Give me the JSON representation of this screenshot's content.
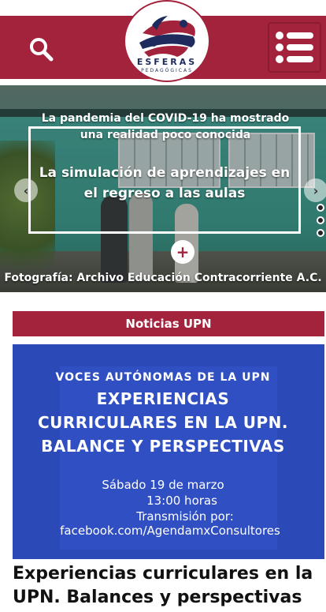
{
  "header": {
    "logo_text": "ESFERAS",
    "logo_subtext": "PEDAGÓGICAS",
    "colors": {
      "brand": "#a3233d",
      "logo_navy": "#1e2b5c"
    }
  },
  "slider": {
    "kicker": "La pandemia del COVID-19 ha mostrado una realidad poco conocida",
    "title": "La simulación de aprendizajes en el regreso a las aulas",
    "caption": "Fotografía: Archivo Educación Contracorriente A.C.",
    "plus_label": "+",
    "prev_icon": "‹",
    "next_icon": "›"
  },
  "section": {
    "title": "Noticias UPN"
  },
  "card": {
    "kicker": "VOCES AUTÓNOMAS DE LA UPN",
    "headline": "EXPERIENCIAS CURRICULARES EN LA UPN. BALANCE Y PERSPECTIVAS",
    "date": "Sábado 19 de marzo",
    "time": "13:00 horas",
    "transmission": "Transmisión por:",
    "link": "facebook.com/AgendamxConsultores",
    "colors": {
      "background": "#2b49b7"
    }
  },
  "article": {
    "title": "Experiencias curriculares en la UPN. Balances y perspectivas"
  }
}
